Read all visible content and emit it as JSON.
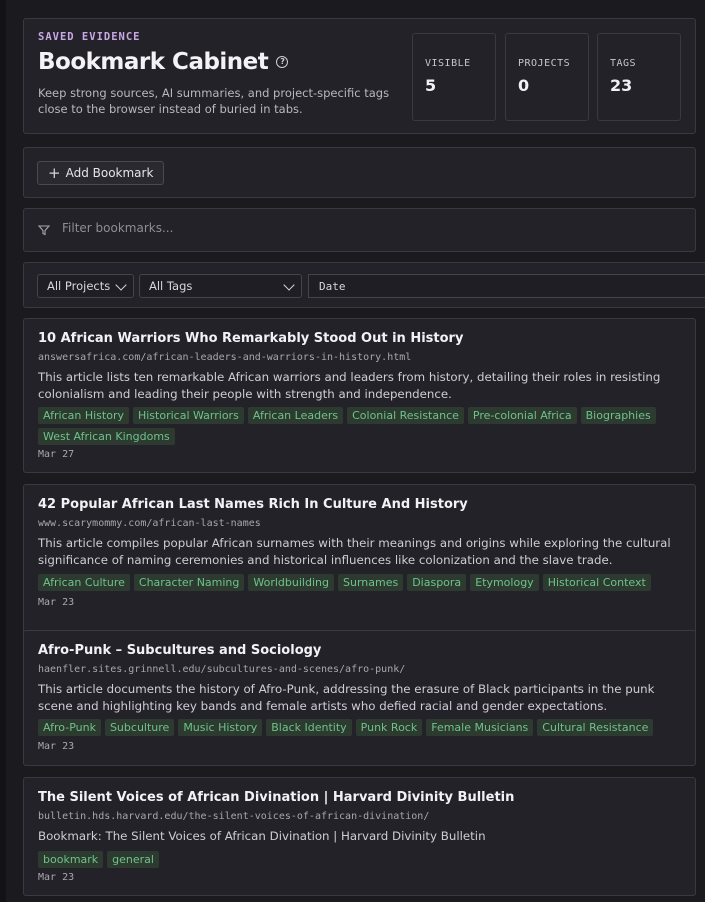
{
  "header": {
    "eyebrow": "SAVED EVIDENCE",
    "title": "Bookmark Cabinet",
    "subtitle": "Keep strong sources, AI summaries, and project-specific tags close to the browser instead of buried in tabs.",
    "stats": [
      {
        "label": "VISIBLE",
        "value": "5"
      },
      {
        "label": "PROJECTS",
        "value": "0"
      },
      {
        "label": "TAGS",
        "value": "23"
      }
    ]
  },
  "toolbar": {
    "add_label": "Add Bookmark"
  },
  "filter": {
    "placeholder": "Filter bookmarks..."
  },
  "selectors": {
    "projects": "All Projects",
    "tags": "All Tags",
    "date": "Date"
  },
  "bookmarks": [
    {
      "title": "10 African Warriors Who Remarkably Stood Out in History",
      "url": "answersafrica.com/african-leaders-and-warriors-in-history.html",
      "description": "This article lists ten remarkable African warriors and leaders from history, detailing their roles in resisting colonialism and leading their people with strength and independence.",
      "tags": [
        "African History",
        "Historical Warriors",
        "African Leaders",
        "Colonial Resistance",
        "Pre-colonial Africa",
        "Biographies",
        "West African Kingdoms"
      ],
      "date": "Mar 27"
    },
    {
      "title": "42 Popular African Last Names Rich In Culture And History",
      "url": "www.scarymommy.com/african-last-names",
      "description": "This article compiles popular African surnames with their meanings and origins while exploring the cultural significance of naming ceremonies and historical influences like colonization and the slave trade.",
      "tags": [
        "African Culture",
        "Character Naming",
        "Worldbuilding",
        "Surnames",
        "Diaspora",
        "Etymology",
        "Historical Context"
      ],
      "date": "Mar 23"
    },
    {
      "title": "Afro-Punk – Subcultures and Sociology",
      "url": "haenfler.sites.grinnell.edu/subcultures-and-scenes/afro-punk/",
      "description": "This article documents the history of Afro-Punk, addressing the erasure of Black participants in the punk scene and highlighting key bands and female artists who defied racial and gender expectations.",
      "tags": [
        "Afro-Punk",
        "Subculture",
        "Music History",
        "Black Identity",
        "Punk Rock",
        "Female Musicians",
        "Cultural Resistance"
      ],
      "date": "Mar 23"
    },
    {
      "title": "The Silent Voices of African Divination | Harvard Divinity Bulletin",
      "url": "bulletin.hds.harvard.edu/the-silent-voices-of-african-divination/",
      "description": "Bookmark: The Silent Voices of African Divination | Harvard Divinity Bulletin",
      "tags": [
        "bookmark",
        "general"
      ],
      "date": "Mar 23"
    }
  ],
  "colors": {
    "accent": "#c9a8e6",
    "tag_text": "#6fc28a",
    "tag_bg": "#2c3a30",
    "background": "#1b1a1f"
  }
}
